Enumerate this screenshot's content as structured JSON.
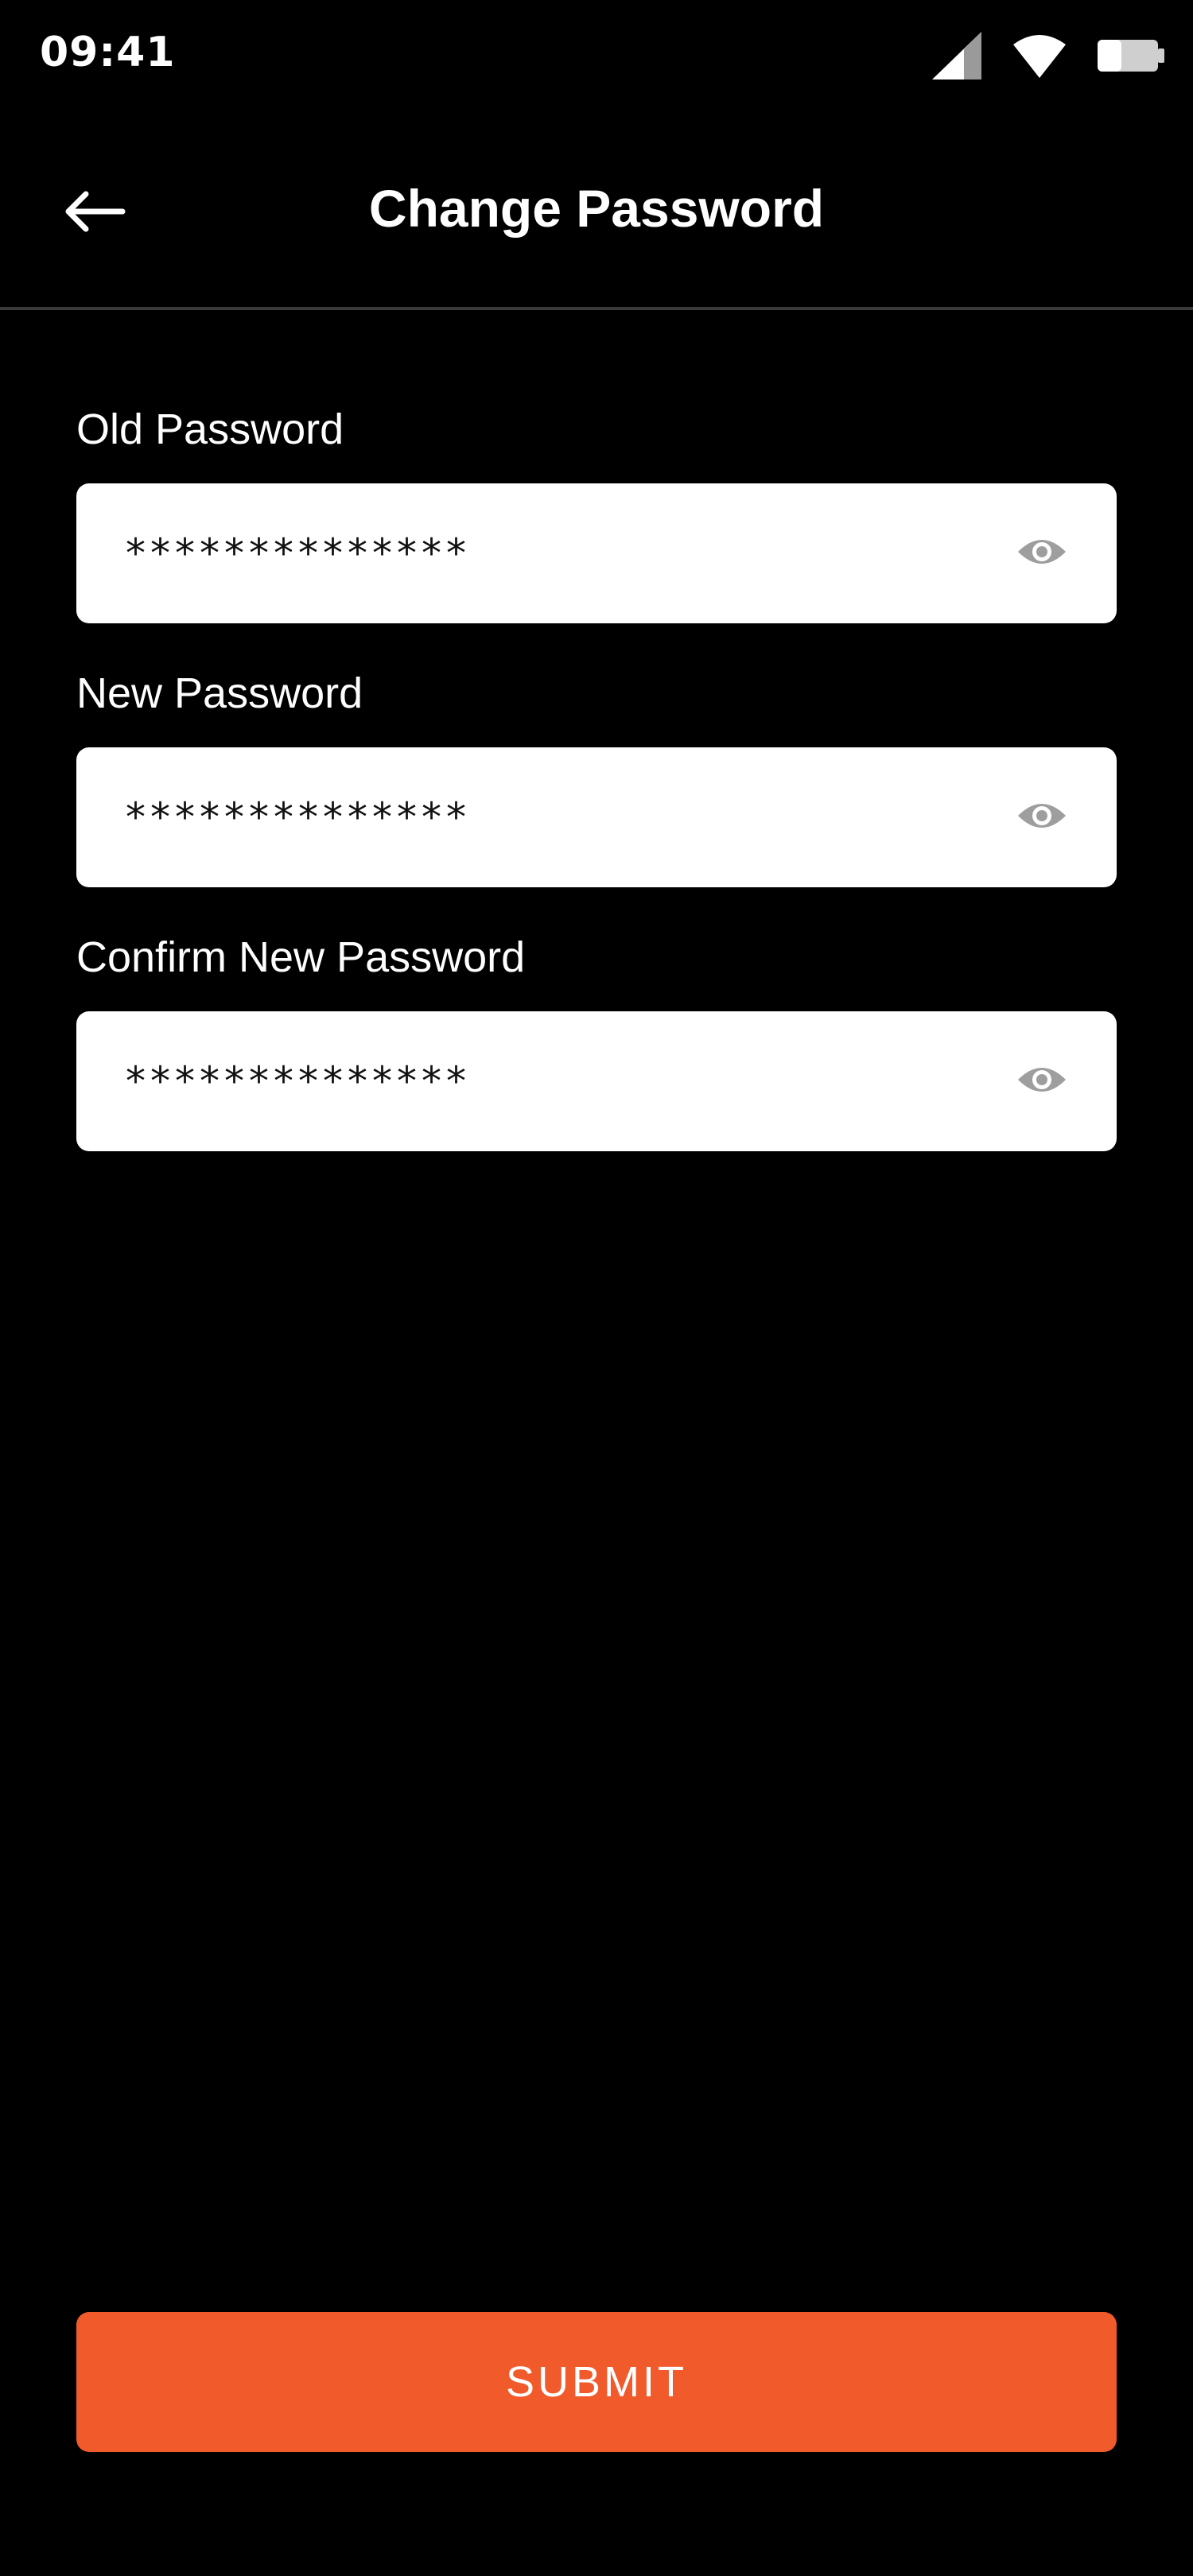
{
  "status_bar": {
    "time": "09:41",
    "icons": [
      "cellular-signal-icon",
      "wifi-icon",
      "battery-icon"
    ]
  },
  "app_bar": {
    "back_icon": "arrow-left-icon",
    "title": "Change Password"
  },
  "form": {
    "old_password": {
      "label": "Old Password",
      "value": "**************",
      "toggle_icon": "eye-icon"
    },
    "new_password": {
      "label": "New Password",
      "value": "**************",
      "toggle_icon": "eye-icon"
    },
    "confirm_password": {
      "label": "Confirm New Password",
      "value": "**************",
      "toggle_icon": "eye-icon"
    }
  },
  "submit": {
    "label": "SUBMIT"
  },
  "colors": {
    "background": "#000000",
    "accent": "#f15a2b",
    "field_background": "#ffffff",
    "icon_gray": "#9e9e9e",
    "divider": "#3a3a3a"
  }
}
